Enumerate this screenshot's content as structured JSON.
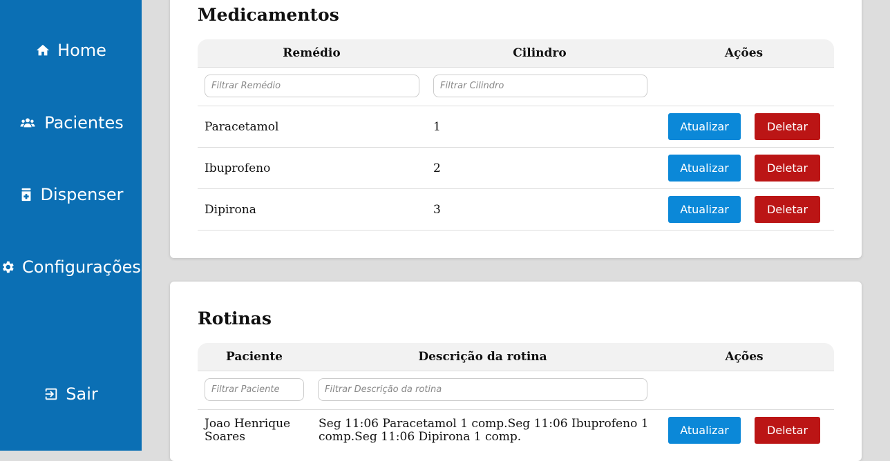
{
  "sidebar": {
    "items": [
      {
        "label": "Home",
        "icon": "home-icon"
      },
      {
        "label": "Pacientes",
        "icon": "users-icon"
      },
      {
        "label": "Dispenser",
        "icon": "medicine-box-icon"
      },
      {
        "label": "Configurações",
        "icon": "gear-icon"
      },
      {
        "label": "Sair",
        "icon": "logout-icon"
      }
    ]
  },
  "medicamentos": {
    "title": "Medicamentos",
    "headers": [
      "Remédio",
      "Cilindro",
      "Ações"
    ],
    "filters": {
      "remedio": "Filtrar Remédio",
      "cilindro": "Filtrar Cilindro"
    },
    "rows": [
      {
        "remedio": "Paracetamol",
        "cilindro": "1"
      },
      {
        "remedio": "Ibuprofeno",
        "cilindro": "2"
      },
      {
        "remedio": "Dipirona",
        "cilindro": "3"
      }
    ]
  },
  "rotinas": {
    "title": "Rotinas",
    "headers": [
      "Paciente",
      "Descrição da rotina",
      "Ações"
    ],
    "filters": {
      "paciente": "Filtrar Paciente",
      "descricao": "Filtrar Descrição da rotina"
    },
    "rows": [
      {
        "paciente": "Joao Henrique Soares",
        "descricao": "Seg 11:06 Paracetamol 1 comp.Seg 11:06 Ibuprofeno 1 comp.Seg 11:06 Dipirona 1 comp."
      }
    ]
  },
  "actions": {
    "update": "Atualizar",
    "delete": "Deletar"
  },
  "colors": {
    "sidebar": "#0b6fb4",
    "update": "#0b88d8",
    "delete": "#bb1515",
    "background": "#dddddd"
  }
}
